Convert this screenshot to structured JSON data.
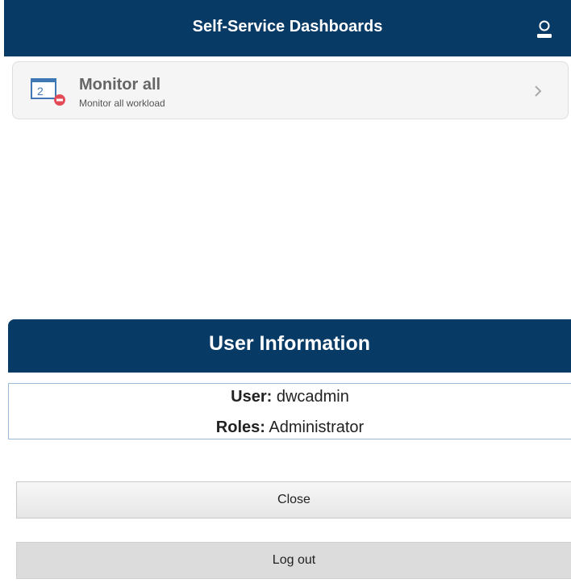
{
  "header": {
    "title": "Self-Service Dashboards",
    "user_icon": "user-icon"
  },
  "list": {
    "items": [
      {
        "title": "Monitor all",
        "subtitle": "Monitor all workload",
        "icon": "dashboard-monitor-icon",
        "icon_number": "2"
      }
    ]
  },
  "dialog": {
    "title": "User Information",
    "user_label": "User:",
    "user_value": "dwcadmin",
    "roles_label": "Roles:",
    "roles_value": "Administrator",
    "close_label": "Close",
    "logout_label": "Log out"
  },
  "colors": {
    "header_bg": "#083a66",
    "badge_red": "#e34b57",
    "icon_blue": "#3f78b5"
  }
}
